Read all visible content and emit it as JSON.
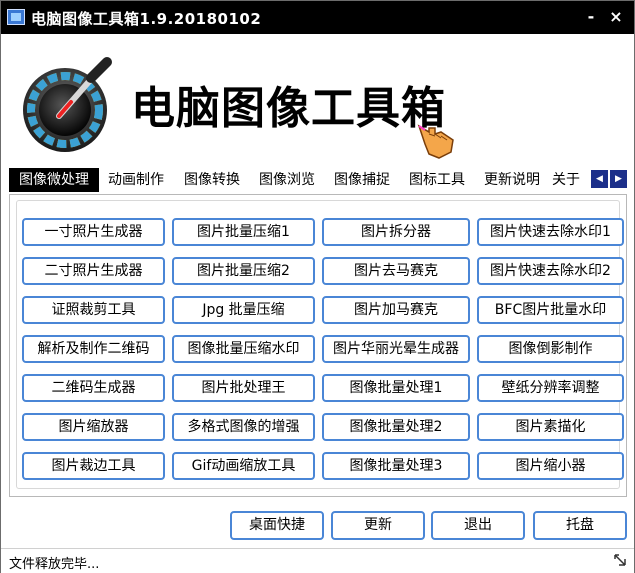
{
  "window": {
    "title": "电脑图像工具箱1.9.20180102",
    "minimize_label": "-",
    "close_label": "×"
  },
  "banner": {
    "title": "电脑图像工具箱"
  },
  "tabs": [
    {
      "label": "图像微处理",
      "active": true
    },
    {
      "label": "动画制作"
    },
    {
      "label": "图像转换"
    },
    {
      "label": "图像浏览"
    },
    {
      "label": "图像捕捉"
    },
    {
      "label": "图标工具"
    },
    {
      "label": "更新说明"
    },
    {
      "label": "关于"
    }
  ],
  "tab_scroll": {
    "left": "◀",
    "right": "▶"
  },
  "grid": [
    [
      "一寸照片生成器",
      "图片批量压缩1",
      "图片拆分器",
      "图片快速去除水印1"
    ],
    [
      "二寸照片生成器",
      "图片批量压缩2",
      "图片去马赛克",
      "图片快速去除水印2"
    ],
    [
      "证照裁剪工具",
      "Jpg 批量压缩",
      "图片加马赛克",
      "BFC图片批量水印"
    ],
    [
      "解析及制作二维码",
      "图像批量压缩水印",
      "图片华丽光晕生成器",
      "图像倒影制作"
    ],
    [
      "二维码生成器",
      "图片批处理王",
      "图像批量处理1",
      "壁纸分辨率调整"
    ],
    [
      "图片缩放器",
      "多格式图像的增强",
      "图像批量处理2",
      "图片素描化"
    ],
    [
      "图片裁边工具",
      "Gif动画缩放工具",
      "图像批量处理3",
      "图片缩小器"
    ]
  ],
  "bottom_buttons": {
    "desktop_shortcut": "桌面快捷",
    "update": "更新",
    "exit": "退出",
    "tray": "托盘"
  },
  "status": {
    "text": "文件释放完毕..."
  },
  "colors": {
    "titlebar": "#000000",
    "button_border": "#4a86d6",
    "tab_scroll": "#1c2f8a"
  },
  "icons": {
    "app": "app-icon",
    "logo": "color-wheel-eyedropper-icon",
    "hand": "pointing-hand-icon",
    "grip": "resize-grip-icon"
  }
}
